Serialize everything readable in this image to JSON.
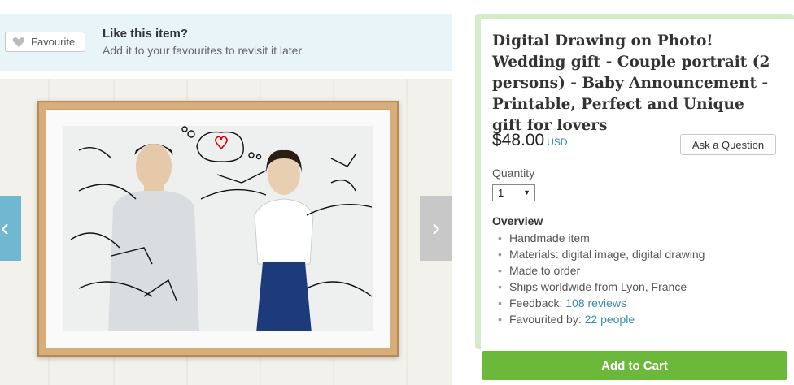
{
  "favourite": {
    "button_label": "Favourite",
    "title": "Like this item?",
    "subtitle": "Add it to your favourites to revisit it later."
  },
  "gallery": {
    "prev_icon": "chevron-left-icon",
    "next_icon": "chevron-right-icon"
  },
  "listing": {
    "title": "Digital Drawing on Photo! Wedding gift - Couple portrait (2 persons) - Baby Announcement - Printable, Perfect and Unique gift for lovers",
    "price": "$48.00",
    "currency": "USD",
    "ask_label": "Ask a Question",
    "quantity_label": "Quantity",
    "quantity_value": "1",
    "overview_label": "Overview",
    "overview": {
      "item1": "Handmade item",
      "item2": "Materials: digital image, digital drawing",
      "item3": "Made to order",
      "item4": "Ships worldwide from Lyon, France",
      "feedback_label": "Feedback: ",
      "feedback_link": "108 reviews",
      "favourited_label": "Favourited by: ",
      "favourited_link": "22 people"
    },
    "cart_label": "Add to Cart"
  },
  "colors": {
    "accent_blue": "#3a8ca6",
    "cart_green": "#6cb83a",
    "panel_border": "#d4ecc9",
    "banner_bg": "#e8f4f8"
  }
}
